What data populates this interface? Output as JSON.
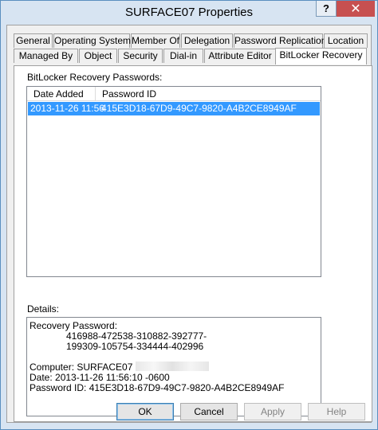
{
  "window": {
    "title": "SURFACE07 Properties",
    "help_label": "?",
    "close_label": "✕"
  },
  "tabs_row1": [
    {
      "label": "General"
    },
    {
      "label": "Operating System"
    },
    {
      "label": "Member Of"
    },
    {
      "label": "Delegation"
    },
    {
      "label": "Password Replication"
    },
    {
      "label": "Location"
    }
  ],
  "tabs_row2": [
    {
      "label": "Managed By"
    },
    {
      "label": "Object"
    },
    {
      "label": "Security"
    },
    {
      "label": "Dial-in"
    },
    {
      "label": "Attribute Editor"
    },
    {
      "label": "BitLocker Recovery",
      "active": true
    }
  ],
  "recovery": {
    "label": "BitLocker Recovery Passwords:",
    "columns": [
      "Date Added",
      "Password ID"
    ],
    "rows": [
      {
        "date_added": "2013-11-26 11:56",
        "password_id": "415E3D18-67D9-49C7-9820-A4B2CE8949AF",
        "selected": true
      }
    ]
  },
  "details": {
    "label": "Details:",
    "recovery_password_label": "Recovery Password:",
    "recovery_password_line1": "416988-472538-310882-392777-",
    "recovery_password_line2": "199309-105754-334444-402996",
    "computer": "Computer: SURFACE07",
    "date": "Date: 2013-11-26 11:56:10 -0600",
    "password_id": "Password ID: 415E3D18-67D9-49C7-9820-A4B2CE8949AF"
  },
  "buttons": {
    "ok": "OK",
    "cancel": "Cancel",
    "apply": "Apply",
    "help": "Help"
  }
}
